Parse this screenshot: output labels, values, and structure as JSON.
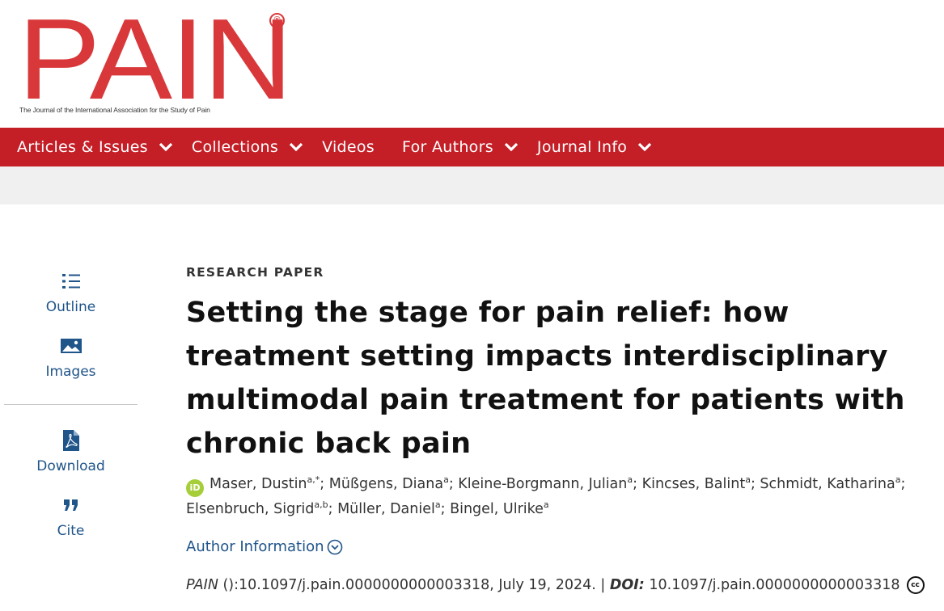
{
  "logo": {
    "text": "PAIN",
    "registered": "®",
    "tagline": "The Journal of the International Association for the Study of Pain",
    "color": "#d9383a"
  },
  "nav": {
    "color": "#c41e26",
    "items": [
      {
        "label": "Articles & Issues",
        "dropdown": true
      },
      {
        "label": "Collections",
        "dropdown": true
      },
      {
        "label": "Videos",
        "dropdown": false
      },
      {
        "label": "For Authors",
        "dropdown": true
      },
      {
        "label": "Journal Info",
        "dropdown": true
      }
    ]
  },
  "sidebar": {
    "items": [
      {
        "label": "Outline",
        "icon": "outline-list-icon"
      },
      {
        "label": "Images",
        "icon": "image-icon"
      },
      {
        "label": "Download",
        "icon": "pdf-icon"
      },
      {
        "label": "Cite",
        "icon": "quote-icon"
      }
    ]
  },
  "article": {
    "type": "RESEARCH PAPER",
    "title": "Setting the stage for pain relief: how treatment setting impacts interdisciplinary multimodal pain treatment for patients with chronic back pain",
    "authors": [
      {
        "name": "Maser, Dustin",
        "sup": "a,*",
        "orcid": true
      },
      {
        "name": "Müßgens, Diana",
        "sup": "a"
      },
      {
        "name": "Kleine-Borgmann, Julian",
        "sup": "a"
      },
      {
        "name": "Kincses, Balint",
        "sup": "a"
      },
      {
        "name": "Schmidt, Katharina",
        "sup": "a"
      },
      {
        "name": "Elsenbruch, Sigrid",
        "sup": "a,b"
      },
      {
        "name": "Müller, Daniel",
        "sup": "a"
      },
      {
        "name": "Bingel, Ulrike",
        "sup": "a"
      }
    ],
    "author_info_label": "Author Information",
    "citation": {
      "journal": "PAIN",
      "ref": " ():10.1097/j.pain.0000000000003318, July 19, 2024. | ",
      "doi_label": "DOI:",
      "doi": " 10.1097/j.pain.0000000000003318",
      "license": "cc"
    }
  }
}
